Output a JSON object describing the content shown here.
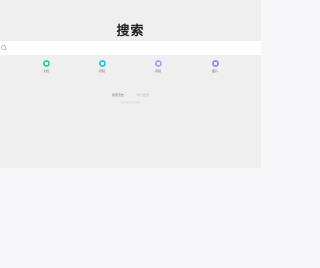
{
  "header": {
    "title": "搜索"
  },
  "search": {
    "placeholder": ""
  },
  "categories": [
    {
      "label": "文档",
      "color": "#3fc9b0",
      "icon": "document-icon"
    },
    {
      "label": "视频",
      "color": "#3ebfe6",
      "icon": "video-icon"
    },
    {
      "label": "音频",
      "color": "#c39bf0",
      "icon": "audio-icon"
    },
    {
      "label": "图片",
      "color": "#9d90ef",
      "icon": "image-icon"
    }
  ],
  "tabs": [
    {
      "label": "搜索历史",
      "active": true
    },
    {
      "label": "热门搜索",
      "active": false
    }
  ],
  "empty_hint": "暂无搜索历史记录"
}
